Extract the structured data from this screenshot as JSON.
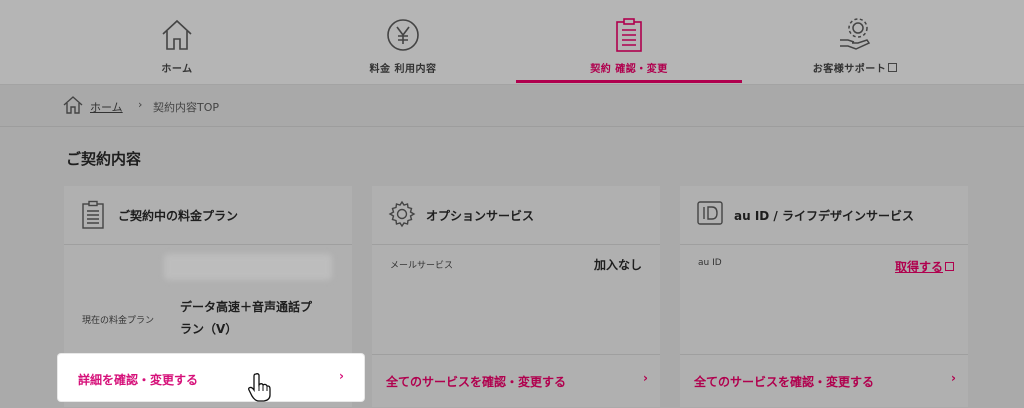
{
  "nav": {
    "items": [
      {
        "label": "ホーム",
        "icon": "home-icon"
      },
      {
        "label": "料金 利用内容",
        "icon": "yen-icon"
      },
      {
        "label": "契約 確認・変更",
        "icon": "clipboard-icon",
        "active": true
      },
      {
        "label": "お客様サポート",
        "icon": "support-gear-icon",
        "external": true
      }
    ]
  },
  "breadcrumb": {
    "home": "ホーム",
    "separator": "›",
    "current": "契約内容TOP"
  },
  "section_title": "ご契約内容",
  "cards": {
    "plan": {
      "title": "ご契約中の料金プラン",
      "current_label": "現在の料金プラン",
      "current_value_line1": "データ高速＋音声通話プ",
      "current_value_line2": "ラン（V）",
      "footer_link": "詳細を確認・変更する",
      "chevron": "›"
    },
    "options": {
      "title": "オプションサービス",
      "mail_label": "メールサービス",
      "mail_value": "加入なし",
      "footer_link": "全てのサービスを確認・変更する",
      "chevron": "›"
    },
    "auid": {
      "title": "au ID / ライフデザインサービス",
      "id_label": "au ID",
      "id_link": "取得する",
      "footer_link": "全てのサービスを確認・変更する",
      "chevron": "›"
    }
  },
  "colors": {
    "accent": "#b0004e",
    "accent_bright": "#d6117a"
  }
}
